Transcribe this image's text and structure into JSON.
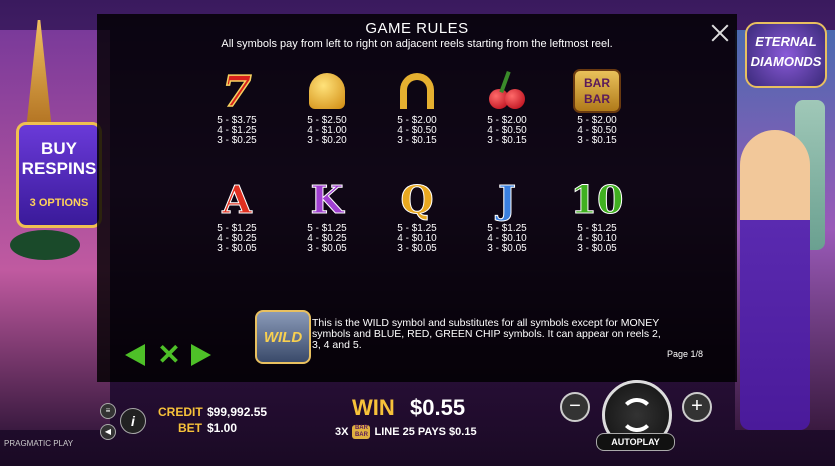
{
  "modal": {
    "title": "GAME RULES",
    "subtitle": "All symbols pay from left to right on adjacent reels starting from the leftmost reel.",
    "page": "Page 1/8",
    "wild_label": "WILD",
    "wild_text": "This is the WILD symbol and substitutes for all symbols except for MONEY symbols and BLUE, RED, GREEN CHIP symbols. It can appear on reels 2, 3, 4 and 5."
  },
  "symbols": [
    {
      "name": "seven",
      "label": "7",
      "pays": [
        "5 - $3.75",
        "4 - $1.25",
        "3 - $0.25"
      ]
    },
    {
      "name": "bell",
      "label": "",
      "pays": [
        "5 - $2.50",
        "4 - $1.00",
        "3 - $0.20"
      ]
    },
    {
      "name": "horseshoe",
      "label": "",
      "pays": [
        "5 - $2.00",
        "4 - $0.50",
        "3 - $0.15"
      ]
    },
    {
      "name": "cherry",
      "label": "",
      "pays": [
        "5 - $2.00",
        "4 - $0.50",
        "3 - $0.15"
      ]
    },
    {
      "name": "bar",
      "label": "BAR BAR",
      "pays": [
        "5 - $2.00",
        "4 - $0.50",
        "3 - $0.15"
      ]
    },
    {
      "name": "a",
      "label": "A",
      "color": "#e03020",
      "pays": [
        "5 - $1.25",
        "4 - $0.25",
        "3 - $0.05"
      ]
    },
    {
      "name": "k",
      "label": "K",
      "color": "#a040d0",
      "pays": [
        "5 - $1.25",
        "4 - $0.25",
        "3 - $0.05"
      ]
    },
    {
      "name": "q",
      "label": "Q",
      "color": "#e8a820",
      "pays": [
        "5 - $1.25",
        "4 - $0.10",
        "3 - $0.05"
      ]
    },
    {
      "name": "j",
      "label": "J",
      "color": "#3a80e0",
      "pays": [
        "5 - $1.25",
        "4 - $0.10",
        "3 - $0.05"
      ]
    },
    {
      "name": "ten",
      "label": "10",
      "color": "#40b020",
      "pays": [
        "5 - $1.25",
        "4 - $0.10",
        "3 - $0.05"
      ]
    }
  ],
  "background": {
    "buy_title": "BUY RESPINS",
    "buy_sub": "3 OPTIONS",
    "logo": "ETERNAL DIAMONDS"
  },
  "status": {
    "provider": "PRAGMATIC PLAY",
    "credit_label": "CREDIT",
    "credit_value": "$99,992.55",
    "bet_label": "BET",
    "bet_value": "$1.00",
    "win_label": "WIN",
    "win_value": "$0.55",
    "line_count": "3X",
    "line_symbol": "BAR BAR",
    "line_text": "LINE 25 PAYS $0.15",
    "autoplay": "AUTOPLAY",
    "info": "i",
    "minus": "−",
    "plus": "+"
  },
  "colors": {
    "accent_gold": "#f7c23a",
    "nav_green": "#4ec028"
  }
}
